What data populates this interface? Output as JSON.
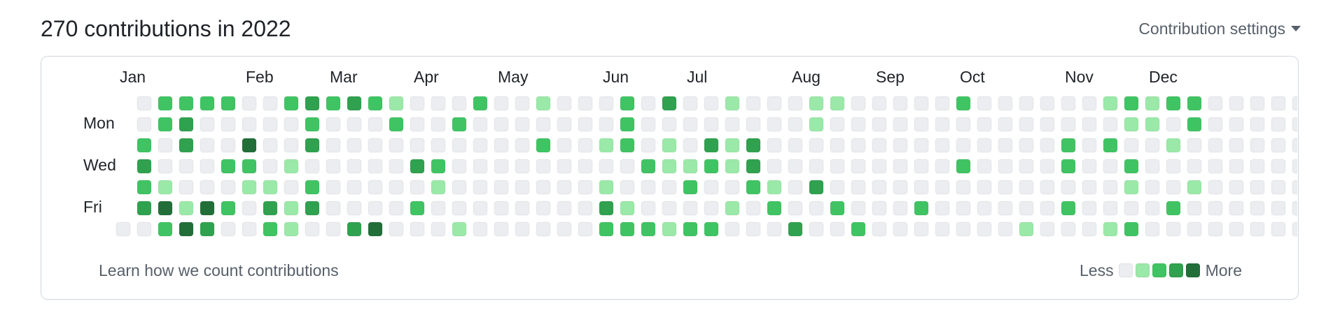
{
  "header": {
    "title": "270 contributions in 2022",
    "settings_label": "Contribution settings"
  },
  "graph": {
    "months": [
      {
        "label": "Jan",
        "week": 0
      },
      {
        "label": "Feb",
        "week": 6
      },
      {
        "label": "Mar",
        "week": 10
      },
      {
        "label": "Apr",
        "week": 14
      },
      {
        "label": "May",
        "week": 18
      },
      {
        "label": "Jun",
        "week": 23
      },
      {
        "label": "Jul",
        "week": 27
      },
      {
        "label": "Aug",
        "week": 32
      },
      {
        "label": "Sep",
        "week": 36
      },
      {
        "label": "Oct",
        "week": 40
      },
      {
        "label": "Nov",
        "week": 45
      },
      {
        "label": "Dec",
        "week": 49
      }
    ],
    "day_labels": [
      {
        "label": "Mon",
        "row": 1
      },
      {
        "label": "Wed",
        "row": 3
      },
      {
        "label": "Fri",
        "row": 5
      }
    ],
    "first_week_start_row": 6,
    "level_colors": [
      "#ebedf0",
      "#9be9a8",
      "#40c463",
      "#30a14e",
      "#216e39"
    ],
    "rows": [
      "0222200232321000200100020300100011000002000000121220000000",
      "0230000020002002000000020000000010000000000000011020000000",
      "2030040030000000000200120103130000000000000020200100000000",
      "3000220100000320000000002112130000000002000020020000000000",
      "2100011020000010000000100020021030000000000000010010000000",
      "3414203130000200000000310000102002000200000020000200000000",
      "0243002100340001000000222122000300200000001000120000000000"
    ]
  },
  "footer": {
    "learn_label": "Learn how we count contributions",
    "legend_less": "Less",
    "legend_more": "More"
  }
}
